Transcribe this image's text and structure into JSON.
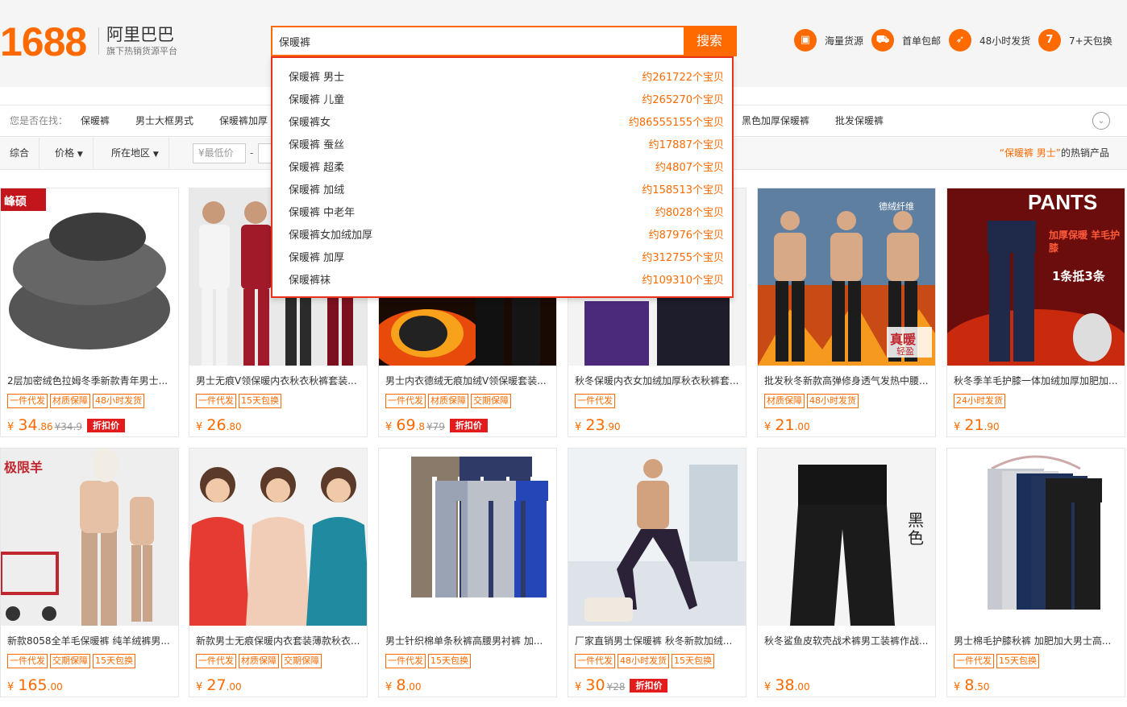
{
  "brand": {
    "logo_number": "1688",
    "name": "阿里巴巴",
    "tagline": "旗下热销货源平台"
  },
  "search": {
    "value": "保暖裤",
    "button": "搜索"
  },
  "features": [
    {
      "icon": "box-icon",
      "label": "海量货源"
    },
    {
      "icon": "truck-icon",
      "label": "首单包邮"
    },
    {
      "icon": "rocket-icon",
      "label": "48小时发货"
    },
    {
      "icon": "return-7-icon",
      "glyph": "7",
      "label": "7+天包换"
    }
  ],
  "suggestions": [
    {
      "term": "保暖裤 男士",
      "count": "约261722个宝贝"
    },
    {
      "term": "保暖裤 儿童",
      "count": "约265270个宝贝"
    },
    {
      "term": "保暖裤女",
      "count": "约86555155个宝贝"
    },
    {
      "term": "保暖裤 蚕丝",
      "count": "约17887个宝贝"
    },
    {
      "term": "保暖裤 超柔",
      "count": "约4807个宝贝"
    },
    {
      "term": "保暖裤 加绒",
      "count": "约158513个宝贝"
    },
    {
      "term": "保暖裤 中老年",
      "count": "约8028个宝贝"
    },
    {
      "term": "保暖裤女加绒加厚",
      "count": "约87976个宝贝"
    },
    {
      "term": "保暖裤 加厚",
      "count": "约312755个宝贝"
    },
    {
      "term": "保暖裤袜",
      "count": "约109310个宝贝"
    }
  ],
  "related": {
    "label": "您是否在找：",
    "items": [
      "保暖裤",
      "男士大框男式",
      "保暖裤加厚",
      "黑色加厚保暖裤",
      "批发保暖裤"
    ]
  },
  "filters": {
    "sort": "综合",
    "price": "价格",
    "region": "所在地区",
    "min_price": "¥最低价",
    "dash": "-",
    "hot_keyword": "“保暖裤 男士”",
    "hot_suffix": "的热销产品"
  },
  "products": [
    {
      "title": "2层加密绒色拉姆冬季新款青年男士...",
      "tags": [
        "一件代发",
        "材质保障",
        "48小时发货"
      ],
      "yen": "¥",
      "int": "34",
      "dec": ".86",
      "old": "¥34.9",
      "discount": "折扣价",
      "img": "grey",
      "badge": "峰硕"
    },
    {
      "title": "男士无痕V领保暖内衣秋衣秋裤套装...",
      "tags": [
        "一件代发",
        "15天包换"
      ],
      "yen": "¥",
      "int": "26",
      "dec": ".80",
      "old": "",
      "discount": "",
      "img": "models"
    },
    {
      "title": "男士内衣德绒无痕加绒V领保暖套装...",
      "tags": [
        "一件代发",
        "材质保障",
        "交期保障"
      ],
      "yen": "¥",
      "int": "69",
      "dec": ".8",
      "old": "¥79",
      "discount": "折扣价",
      "img": "fire"
    },
    {
      "title": "秋冬保暖内衣女加绒加厚秋衣秋裤套...",
      "tags": [
        "一件代发"
      ],
      "yen": "¥",
      "int": "23",
      "dec": ".90",
      "old": "",
      "discount": "",
      "img": "purple"
    },
    {
      "title": "批发秋冬新款高弹修身透气发热中腰...",
      "tags": [
        "材质保障",
        "48小时发货"
      ],
      "yen": "¥",
      "int": "21",
      "dec": ".00",
      "old": "",
      "discount": "",
      "img": "men3",
      "overlay": "真暖",
      "overlay2": "轻盈",
      "brandtag": "德绒纤维"
    },
    {
      "title": "秋冬季羊毛护膝一体加绒加厚加肥加...",
      "tags": [
        "24小时发货"
      ],
      "yen": "¥",
      "int": "21",
      "dec": ".90",
      "old": "",
      "discount": "",
      "img": "pants",
      "overlay": "PANTS",
      "overlay2": "加厚保暖 羊毛护膝",
      "overlay3": "1条抵3条"
    },
    {
      "title": "新款8058全羊毛保暖裤 纯羊绒裤男...",
      "tags": [
        "一件代发",
        "交期保障",
        "15天包换"
      ],
      "yen": "¥",
      "int": "165",
      "dec": ".00",
      "old": "",
      "discount": "",
      "img": "alpaca",
      "badge": "极限羊"
    },
    {
      "title": "新款男士无痕保暖内衣套装薄款秋衣...",
      "tags": [
        "一件代发",
        "材质保障",
        "交期保障"
      ],
      "yen": "¥",
      "int": "27",
      "dec": ".00",
      "old": "",
      "discount": "",
      "img": "women"
    },
    {
      "title": "男士针织棉单条秋裤高腰男衬裤 加...",
      "tags": [
        "一件代发",
        "15天包换"
      ],
      "yen": "¥",
      "int": "8",
      "dec": ".00",
      "old": "",
      "discount": "",
      "img": "flat"
    },
    {
      "title": "厂家直销男士保暖裤 秋冬新款加绒...",
      "tags": [
        "一件代发",
        "48小时发货",
        "15天包换"
      ],
      "yen": "¥",
      "int": "30",
      "dec": "",
      "old": "¥28",
      "discount": "折扣价",
      "img": "room"
    },
    {
      "title": "秋冬鲨鱼皮软壳战术裤男工装裤作战...",
      "tags": [],
      "yen": "¥",
      "int": "38",
      "dec": ".00",
      "old": "",
      "discount": "",
      "img": "black",
      "overlay": "黑色"
    },
    {
      "title": "男士棉毛护膝秋裤 加肥加大男士高...",
      "tags": [
        "一件代发",
        "15天包换"
      ],
      "yen": "¥",
      "int": "8",
      "dec": ".50",
      "old": "",
      "discount": "",
      "img": "hangers"
    }
  ],
  "colors": {
    "accent": "#ff6a00",
    "sale": "#e21c1c",
    "border_focus": "#e8321c"
  }
}
